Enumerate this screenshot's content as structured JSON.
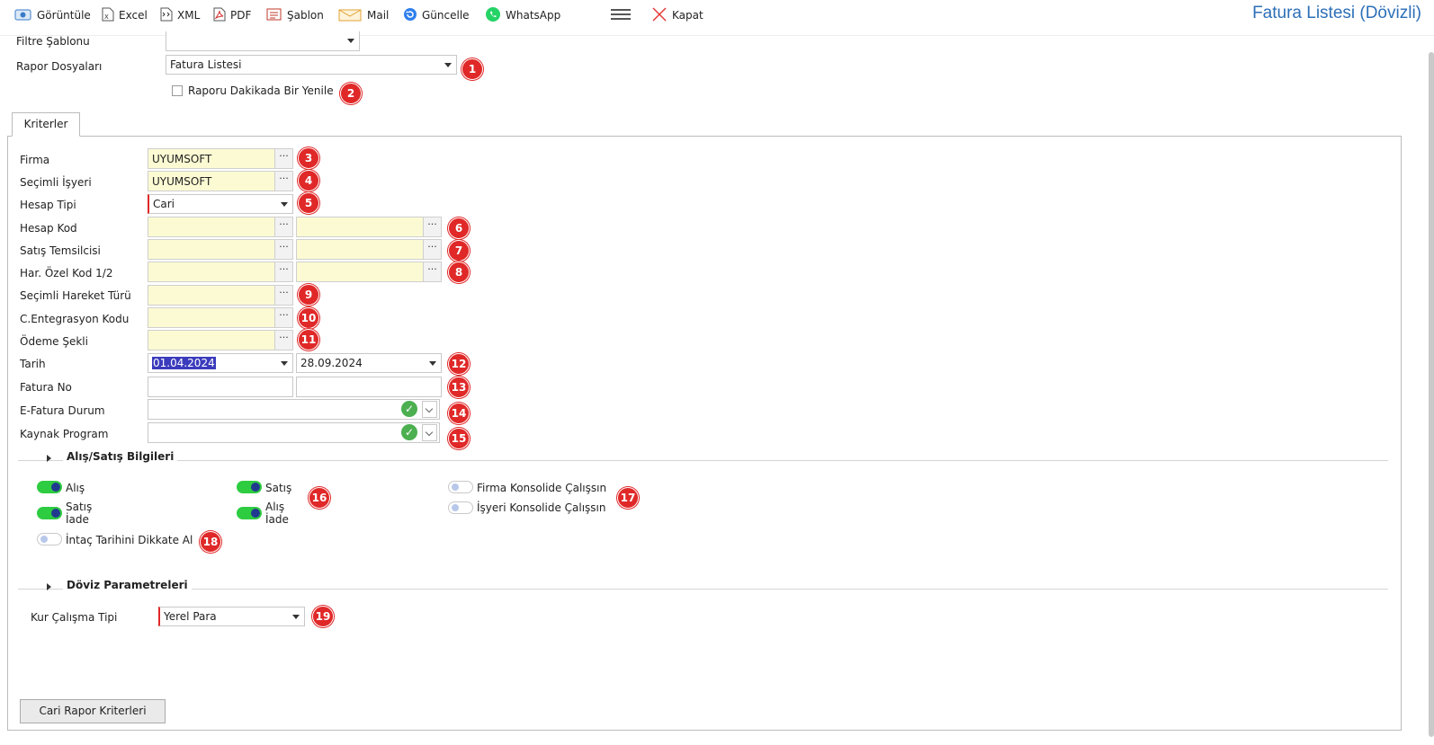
{
  "toolbar": {
    "view_label": "Görüntüle",
    "excel_label": "Excel",
    "xml_label": "XML",
    "pdf_label": "PDF",
    "template_label": "Şablon",
    "mail_label": "Mail",
    "refresh_label": "Güncelle",
    "whatsapp_label": "WhatsApp",
    "close_label": "Kapat"
  },
  "page_title": "Fatura Listesi (Dövizli)",
  "top": {
    "filter_template_label": "Filtre Şablonu",
    "filter_template_value": "",
    "report_files_label": "Rapor Dosyaları",
    "report_files_value": "Fatura Listesi",
    "refresh_checkbox_label": "Raporu Dakikada Bir Yenile"
  },
  "tabs": {
    "criteria": "Kriterler"
  },
  "fields": {
    "firma_label": "Firma",
    "firma_value": "UYUMSOFT",
    "isyeri_label": "Seçimli İşyeri",
    "isyeri_value": "UYUMSOFT",
    "hesap_tipi_label": "Hesap Tipi",
    "hesap_tipi_value": "Cari",
    "hesap_kod_label": "Hesap Kod",
    "satis_temsilcisi_label": "Satış Temsilcisi",
    "har_ozel_kod_label": "Har. Özel Kod 1/2",
    "hareket_turu_label": "Seçimli Hareket Türü",
    "entegrasyon_label": "C.Entegrasyon Kodu",
    "odeme_label": "Ödeme Şekli",
    "tarih_label": "Tarih",
    "tarih_from": "01.04.2024",
    "tarih_to": "28.09.2024",
    "fatura_no_label": "Fatura No",
    "efatura_label": "E-Fatura Durum",
    "kaynak_label": "Kaynak Program"
  },
  "alis_satis": {
    "title": "Alış/Satış Bilgileri",
    "alis": "Alış",
    "satis_iade_1": "Satış",
    "satis_iade_2": "İade",
    "satis": "Satış",
    "alis_iade_1": "Alış",
    "alis_iade_2": "İade",
    "firma_konsolide": "Firma Konsolide Çalışsın",
    "isyeri_konsolide": "İşyeri Konsolide Çalışsın",
    "intac": "İntaç Tarihini Dikkate Al",
    "toggles": {
      "alis": true,
      "satis_iade": true,
      "satis": true,
      "alis_iade": true,
      "firma_konsolide": false,
      "isyeri_konsolide": false,
      "intac": false
    }
  },
  "doviz": {
    "title": "Döviz Parametreleri",
    "kur_label": "Kur Çalışma Tipi",
    "kur_value": "Yerel Para"
  },
  "cari_button": "Cari Rapor Kriterleri",
  "badges": [
    "1",
    "2",
    "3",
    "4",
    "5",
    "6",
    "7",
    "8",
    "9",
    "10",
    "11",
    "12",
    "13",
    "14",
    "15",
    "16",
    "17",
    "18",
    "19"
  ],
  "colors": {
    "accent": "#2c6fb7",
    "badge": "#e02828",
    "lookup_bg": "#fbfad3",
    "toggle_on": "#2ecc40"
  },
  "icons": [
    "view-icon",
    "excel-icon",
    "xml-icon",
    "pdf-icon",
    "template-icon",
    "mail-icon",
    "refresh-icon",
    "whatsapp-icon",
    "menu-icon",
    "close-icon"
  ]
}
